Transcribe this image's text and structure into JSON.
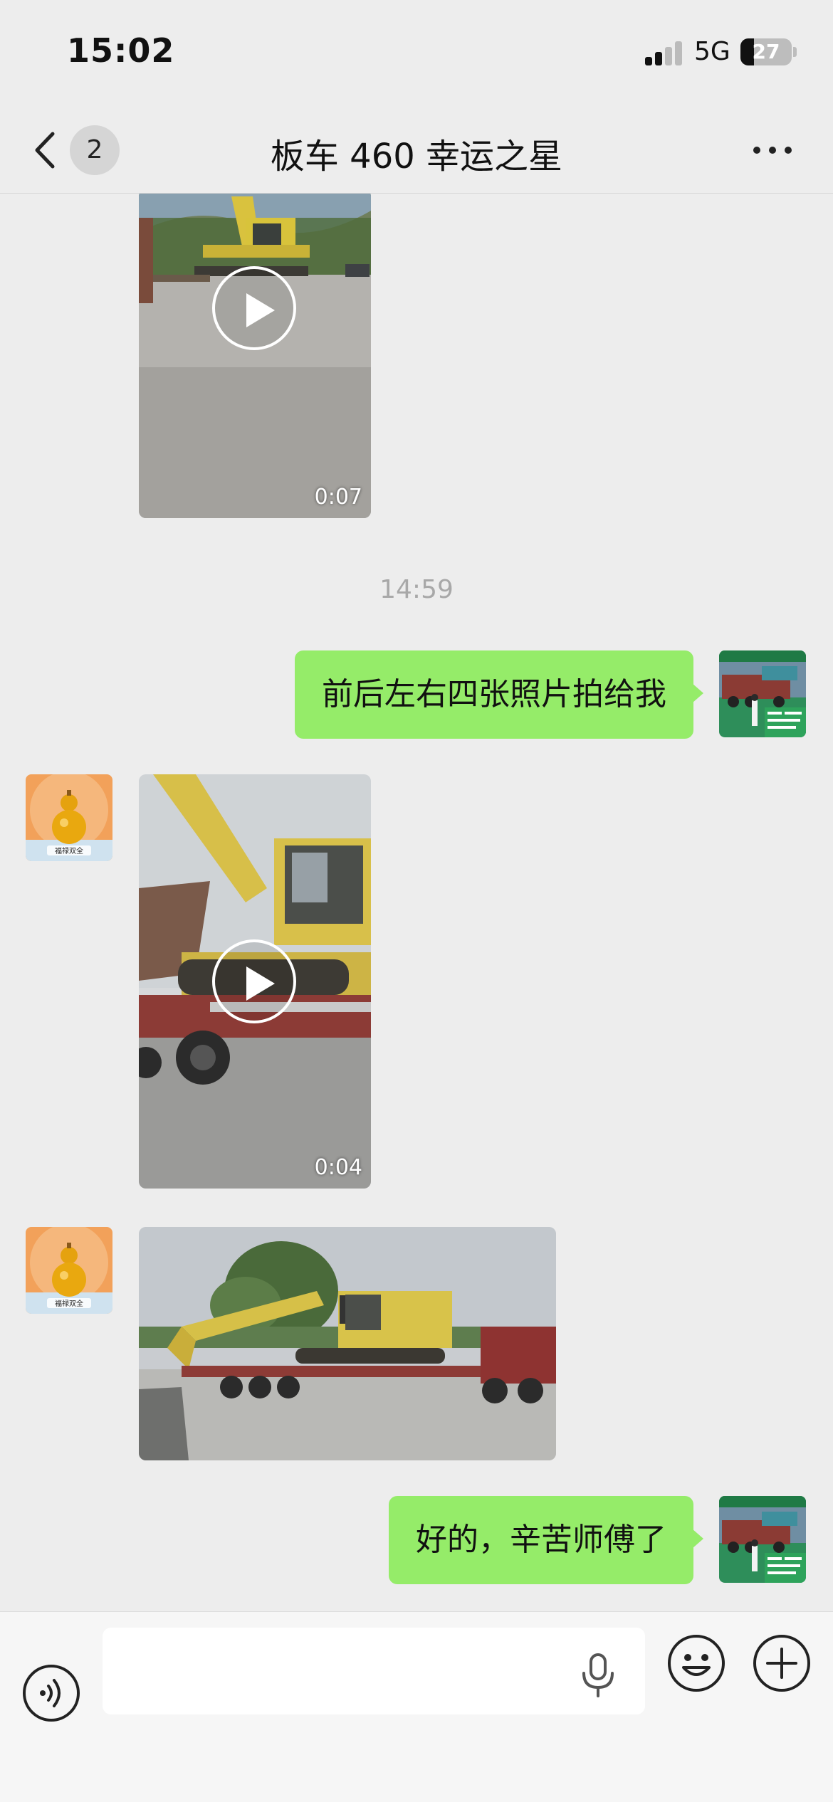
{
  "status_bar": {
    "time": "15:02",
    "network": "5G",
    "battery_text": "27",
    "battery_level": 0.27,
    "signal_bars_active": 2,
    "signal_bars_total": 4
  },
  "header": {
    "back_icon": "chevron-left-icon",
    "unread_count": "2",
    "title": "板车 460 幸运之星",
    "more_icon": "more-dots-icon"
  },
  "messages": [
    {
      "type": "video",
      "side": "incoming",
      "duration": "0:07",
      "content": "excavator-video-thumbnail"
    },
    {
      "type": "timestamp",
      "text": "14:59"
    },
    {
      "type": "text",
      "side": "outgoing",
      "text": "前后左右四张照片拍给我"
    },
    {
      "type": "video",
      "side": "incoming",
      "duration": "0:04",
      "content": "excavator-on-trailer-video-thumbnail"
    },
    {
      "type": "image",
      "side": "incoming",
      "content": "komatsu-excavator-on-lowbed-trailer-photo"
    },
    {
      "type": "text",
      "side": "outgoing",
      "text": "好的，辛苦师傅了"
    }
  ],
  "avatars": {
    "incoming": "golden-gourd-avatar",
    "incoming_caption": "福禄双全",
    "outgoing": "truck-banner-avatar"
  },
  "input_bar": {
    "voice_icon": "voice-toggle-icon",
    "input_value": "",
    "input_placeholder": "",
    "mic_icon": "microphone-icon",
    "emoji_icon": "emoji-face-icon",
    "add_icon": "plus-circle-icon"
  },
  "colors": {
    "background": "#ededed",
    "outgoing_bubble": "#95ec69",
    "timestamp_text": "#a8a8a8"
  }
}
